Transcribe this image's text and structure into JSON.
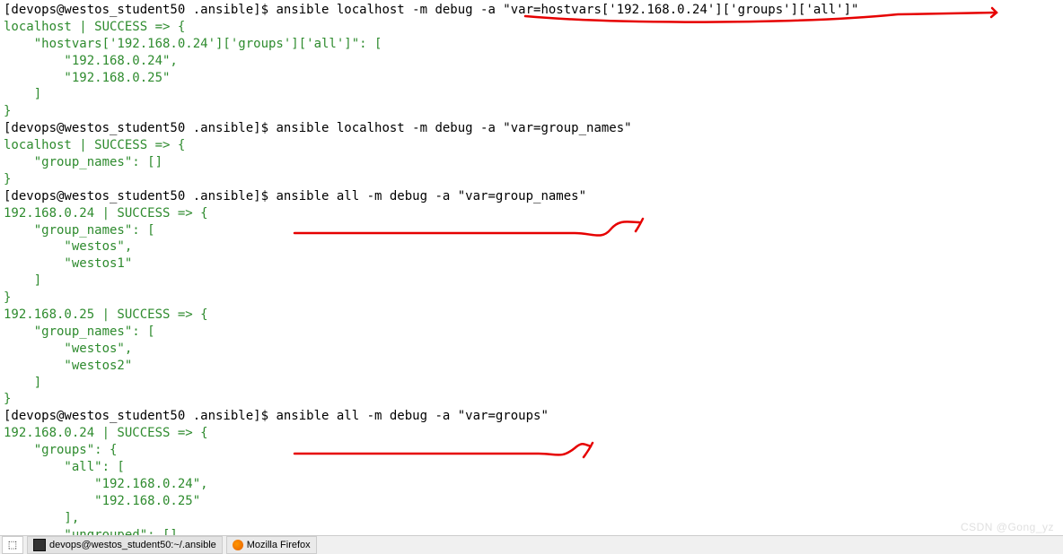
{
  "l1_prompt": "[devops@westos_student50 .ansible]$ ",
  "l1_cmd": "ansible localhost -m debug -a \"var=hostvars['192.168.0.24']['groups']['all']\"",
  "o1": "localhost | SUCCESS => {\n    \"hostvars['192.168.0.24']['groups']['all']\": [\n        \"192.168.0.24\",\n        \"192.168.0.25\"\n    ]\n}",
  "l2_prompt": "[devops@westos_student50 .ansible]$ ",
  "l2_cmd": "ansible localhost -m debug -a \"var=group_names\"",
  "o2": "localhost | SUCCESS => {\n    \"group_names\": []\n}",
  "l3_prompt": "[devops@westos_student50 .ansible]$ ",
  "l3_cmd": "ansible all -m debug -a \"var=group_names\"",
  "o3": "192.168.0.24 | SUCCESS => {\n    \"group_names\": [\n        \"westos\",\n        \"westos1\"\n    ]\n}\n192.168.0.25 | SUCCESS => {\n    \"group_names\": [\n        \"westos\",\n        \"westos2\"\n    ]\n}",
  "l4_prompt": "[devops@westos_student50 .ansible]$ ",
  "l4_cmd": "ansible all -m debug -a \"var=groups\"",
  "o4": "192.168.0.24 | SUCCESS => {\n    \"groups\": {\n        \"all\": [\n            \"192.168.0.24\",\n            \"192.168.0.25\"\n        ],\n        \"ungrouped\": [],",
  "watermark": "CSDN @Gong_yz",
  "task_terminal": "devops@westos_student50:~/.ansible",
  "task_firefox": "Mozilla Firefox",
  "tray_glyph": "⬚"
}
